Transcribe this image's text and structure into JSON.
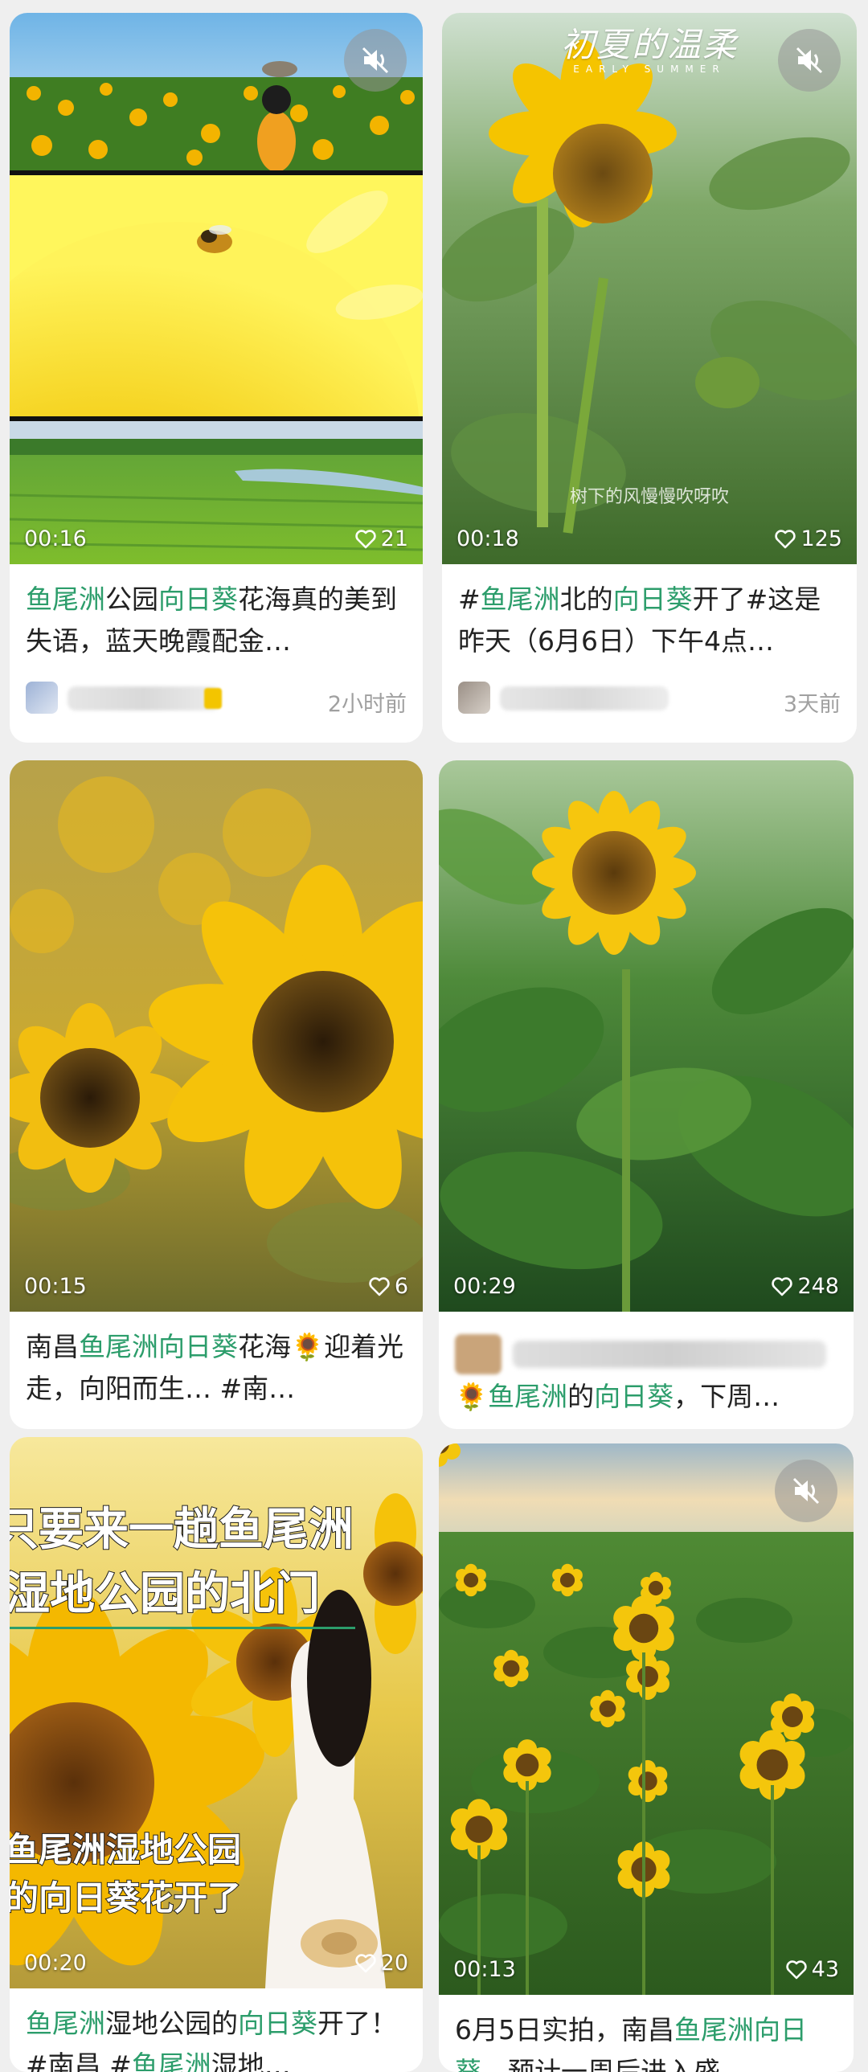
{
  "cards": [
    {
      "duration": "00:16",
      "likes": "21",
      "title_parts": [
        "鱼尾洲",
        "公园",
        "向日葵",
        "花海真的美到失语，蓝天晚霞配金…"
      ],
      "time": "2小时前"
    },
    {
      "watermark_top": "初夏的温柔",
      "watermark_sub": "EARLY SUMMER",
      "caption": "树下的风慢慢吹呀吹",
      "duration": "00:18",
      "likes": "125",
      "title_parts": [
        "#",
        "鱼尾洲",
        "北的",
        "向日葵",
        "开了#这是昨天（6月6日）下午4点…"
      ],
      "time": "3天前"
    },
    {
      "duration": "00:15",
      "likes": "6",
      "title_parts": [
        "南昌",
        "鱼尾洲",
        "向日葵",
        "花海",
        "🌻",
        "迎着光走，向阳而生… #南…"
      ]
    },
    {
      "duration": "00:29",
      "likes": "248",
      "title_parts": [
        "🌻",
        "鱼尾洲",
        "的",
        "向日葵",
        "，下周…"
      ]
    },
    {
      "overlay_line1": "只要来一趟鱼尾洲",
      "overlay_line2": "湿地公园的北门",
      "overlay_line3": "鱼尾洲湿地公园",
      "overlay_line4": "的向日葵花开了",
      "duration": "00:20",
      "likes": "20",
      "title_parts": [
        "鱼尾洲",
        "湿地公园的",
        "向日葵",
        "开了！ #南昌 #",
        "鱼尾洲",
        "湿地…"
      ]
    },
    {
      "duration": "00:13",
      "likes": "43",
      "title_parts": [
        "6月5日实拍，南昌",
        "鱼尾洲向日葵",
        "，预计一周后进入盛…"
      ]
    }
  ],
  "colors": {
    "highlight": "#2c9d6b",
    "background": "#efefef",
    "card": "#ffffff"
  },
  "icons": [
    "mute-icon",
    "heart-icon",
    "sunflower-emoji"
  ]
}
